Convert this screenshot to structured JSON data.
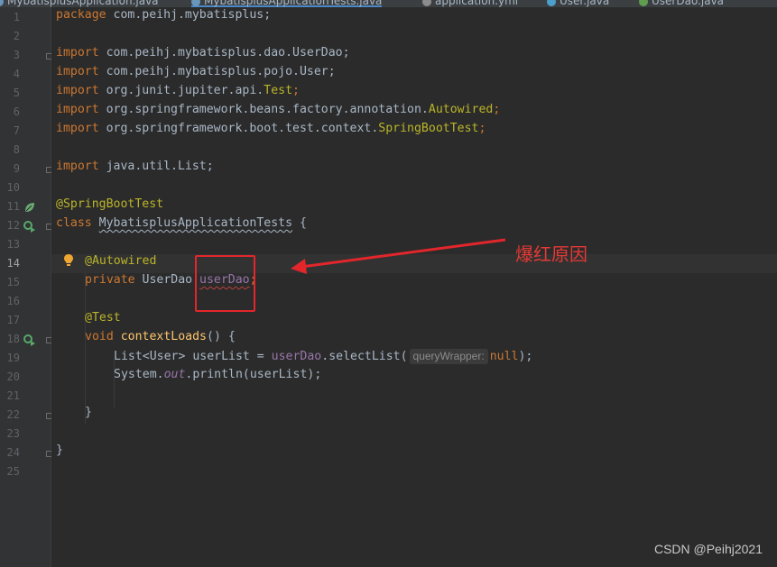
{
  "tabs": [
    {
      "label": "MybatisplusApplication.java",
      "color": "#6897bb"
    },
    {
      "label": "MybatisplusApplicationTests.java",
      "color": "#6897bb",
      "active": true
    },
    {
      "label": "application.yml",
      "color": "#8c8c8c"
    },
    {
      "label": "User.java",
      "color": "#4a9fcb"
    },
    {
      "label": "UserDao.java",
      "color": "#5f9e4f"
    }
  ],
  "lines": [
    {
      "n": "1"
    },
    {
      "n": "2"
    },
    {
      "n": "3"
    },
    {
      "n": "4"
    },
    {
      "n": "5"
    },
    {
      "n": "6"
    },
    {
      "n": "7"
    },
    {
      "n": "8"
    },
    {
      "n": "9"
    },
    {
      "n": "10"
    },
    {
      "n": "11"
    },
    {
      "n": "12"
    },
    {
      "n": "13"
    },
    {
      "n": "14"
    },
    {
      "n": "15"
    },
    {
      "n": "16"
    },
    {
      "n": "17"
    },
    {
      "n": "18"
    },
    {
      "n": "19"
    },
    {
      "n": "20"
    },
    {
      "n": "21"
    },
    {
      "n": "22"
    },
    {
      "n": "23"
    },
    {
      "n": "24"
    },
    {
      "n": "25"
    }
  ],
  "code": {
    "l1_kw": "package",
    "l1_rest": " com.peihj.mybatisplus;",
    "l3_kw": "import",
    "l3_rest": " com.peihj.mybatisplus.dao.UserDao;",
    "l4_kw": "import",
    "l4_rest": " com.peihj.mybatisplus.pojo.User;",
    "l5_kw": "import",
    "l5_rest": " org.junit.jupiter.api.",
    "l5_cls": "Test",
    "l5_end": ";",
    "l6_kw": "import",
    "l6_rest": " org.springframework.beans.factory.annotation.",
    "l6_cls": "Autowired",
    "l6_end": ";",
    "l7_kw": "import",
    "l7_rest": " org.springframework.boot.test.context.",
    "l7_cls": "SpringBootTest",
    "l7_end": ";",
    "l9_kw": "import",
    "l9_rest": " java.util.List;",
    "l11_ann": "@SpringBootTest",
    "l12_kw": "class",
    "l12_name": "MybatisplusApplicationTests",
    "l12_end": " {",
    "l14_ann": "@Autowired",
    "l15_kw": "private",
    "l15_type": " UserDao ",
    "l15_field": "userDao",
    "l15_end": ";",
    "l17_ann": "@Test",
    "l18_kw": "void",
    "l18_method": "contextLoads",
    "l18_end": "() {",
    "l19_a": "List<User> userList = ",
    "l19_field": "userDao",
    "l19_b": ".selectList(",
    "l19_hint": "queryWrapper:",
    "l19_null": "null",
    "l19_end": ");",
    "l20_a": "System.",
    "l20_out": "out",
    "l20_b": ".println(userList);",
    "l22": "}",
    "l24": "}"
  },
  "annotation": {
    "text": "爆红原因",
    "color": "#e53935"
  },
  "watermark": "CSDN @Peihj2021"
}
